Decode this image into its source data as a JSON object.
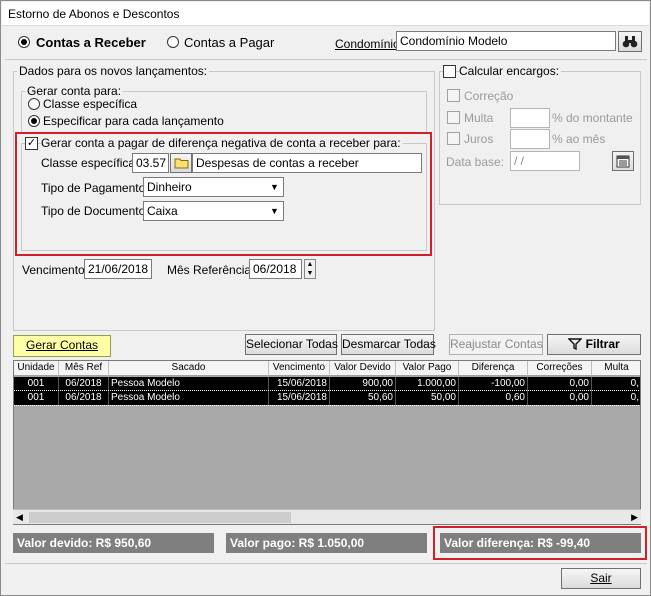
{
  "window": {
    "title": "Estorno de Abonos e Descontos"
  },
  "top": {
    "radio_receber": "Contas a Receber",
    "radio_pagar": "Contas a Pagar",
    "condominio_label": "Condomínio:",
    "condominio_value": "Condomínio Modelo"
  },
  "dados": {
    "title": "Dados para os novos lançamentos:",
    "gerar_title": "Gerar conta para:",
    "opt_classe": "Classe específica",
    "opt_cada": "Especificar para cada lançamento",
    "diff_check": "Gerar conta a pagar de diferença negativa de conta a receber para:",
    "classe_label": "Classe específica",
    "classe_code": "03.57",
    "classe_desc": "Despesas de contas a receber",
    "tipo_pag_label": "Tipo de Pagamento:",
    "tipo_pag_value": "Dinheiro",
    "tipo_doc_label": "Tipo de Documento:",
    "tipo_doc_value": "Caixa",
    "vencimento_label": "Vencimento:",
    "vencimento_value": "21/06/2018",
    "mes_ref_label": "Mês Referência:",
    "mes_ref_value": "06/2018"
  },
  "encargos": {
    "title": "Calcular encargos:",
    "correcao": "Correção",
    "multa": "Multa",
    "multa_unit": "% do montante",
    "juros": "Juros",
    "juros_unit": "% ao mês",
    "data_base_label": "Data base:",
    "data_base_value": " / /"
  },
  "buttons": {
    "gerar": "Gerar Contas",
    "selecionar": "Selecionar Todas",
    "desmarcar": "Desmarcar Todas",
    "reajustar": "Reajustar Contas",
    "filtrar": "Filtrar",
    "sair": "Sair"
  },
  "grid": {
    "columns": [
      "Unidade",
      "Mês Ref",
      "Sacado",
      "Vencimento",
      "Valor Devido",
      "Valor Pago",
      "Diferença",
      "Correções",
      "Multa"
    ],
    "rows": [
      [
        "001",
        "06/2018",
        "Pessoa Modelo",
        "15/06/2018",
        "900,00",
        "1.000,00",
        "-100,00",
        "0,00",
        "0,"
      ],
      [
        "001",
        "06/2018",
        "Pessoa Modelo",
        "15/06/2018",
        "50,60",
        "50,00",
        "0,60",
        "0,00",
        "0,"
      ]
    ]
  },
  "totals": {
    "devido": "Valor devido: R$ 950,60",
    "pago": "Valor pago: R$ 1.050,00",
    "diferenca": "Valor diferença: R$ -99,40"
  },
  "colors": {
    "highlight_button": "#ffffa8",
    "red_outline": "#d0202a",
    "summary_bar": "#7f7f7f"
  }
}
